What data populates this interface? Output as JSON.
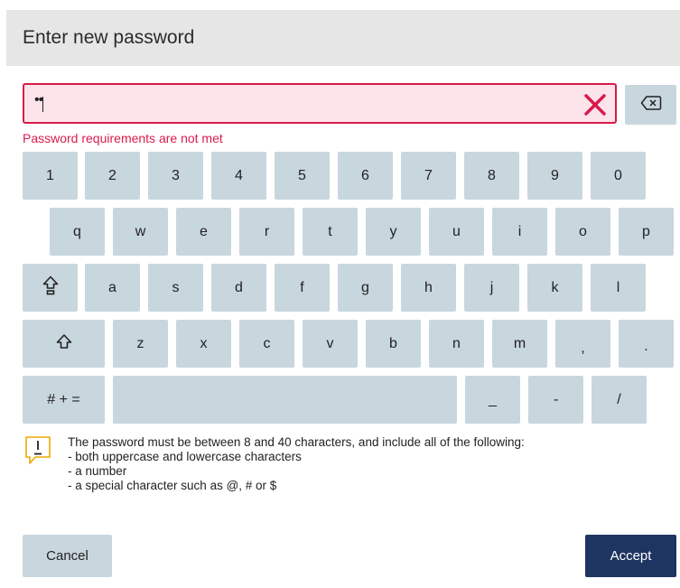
{
  "dialog": {
    "title": "Enter new password"
  },
  "password_field": {
    "masked_value": "••",
    "clear_icon": "close-x-icon",
    "error_text": "Password requirements are not met"
  },
  "backspace": {
    "icon": "backspace-icon"
  },
  "keyboard": {
    "row1": [
      "1",
      "2",
      "3",
      "4",
      "5",
      "6",
      "7",
      "8",
      "9",
      "0"
    ],
    "row2": [
      "q",
      "w",
      "e",
      "r",
      "t",
      "y",
      "u",
      "i",
      "o",
      "p"
    ],
    "row3": [
      "a",
      "s",
      "d",
      "f",
      "g",
      "h",
      "j",
      "k",
      "l"
    ],
    "row4": [
      "z",
      "x",
      "c",
      "v",
      "b",
      "n",
      "m",
      ",",
      "."
    ],
    "symbols_label": "# + =",
    "space_label": "",
    "underscore": "_",
    "dash": "-",
    "slash": "/",
    "caps_lock_icon": "caps-lock-icon",
    "shift_icon": "shift-icon"
  },
  "info": {
    "icon": "warning-speech-icon",
    "lines": [
      "The password must be between 8 and 40 characters, and include all of the following:",
      "- both uppercase and lowercase characters",
      "- a number",
      "- a special character such as @, # or $"
    ]
  },
  "footer": {
    "cancel_label": "Cancel",
    "accept_label": "Accept"
  },
  "colors": {
    "accent": "#1e3461",
    "key_bg": "#c8d6de",
    "error": "#d81b4b",
    "warning": "#f0a800"
  }
}
